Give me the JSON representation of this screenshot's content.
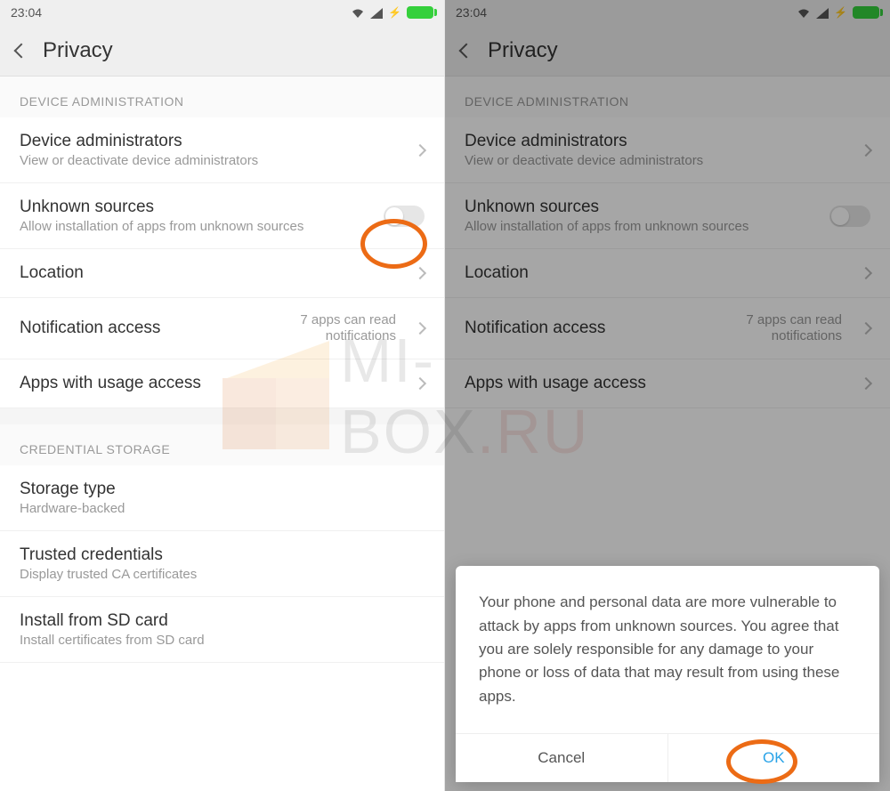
{
  "statusbar": {
    "time": "23:04"
  },
  "header": {
    "title": "Privacy"
  },
  "sections": {
    "device_admin": {
      "label": "DEVICE ADMINISTRATION",
      "items": {
        "device_administrators": {
          "title": "Device administrators",
          "sub": "View or deactivate device administrators"
        },
        "unknown_sources": {
          "title": "Unknown sources",
          "sub": "Allow installation of apps from unknown sources"
        },
        "location": {
          "title": "Location"
        },
        "notification_access": {
          "title": "Notification access",
          "value": "7 apps can read notifications"
        },
        "apps_usage": {
          "title": "Apps with usage access"
        }
      }
    },
    "credential": {
      "label": "CREDENTIAL STORAGE",
      "items": {
        "storage_type": {
          "title": "Storage type",
          "sub": "Hardware-backed"
        },
        "trusted_credentials": {
          "title": "Trusted credentials",
          "sub": "Display trusted CA certificates"
        },
        "install_sd": {
          "title": "Install from SD card",
          "sub": "Install certificates from SD card"
        }
      }
    }
  },
  "dialog": {
    "body": "Your phone and personal data are more vulnerable to attack by apps from unknown sources. You agree that you are solely responsible for any damage to your phone or loss of data that may result from using these apps.",
    "cancel": "Cancel",
    "ok": "OK"
  },
  "watermark": {
    "textA": "MI-BOX",
    "textB": ".RU"
  }
}
